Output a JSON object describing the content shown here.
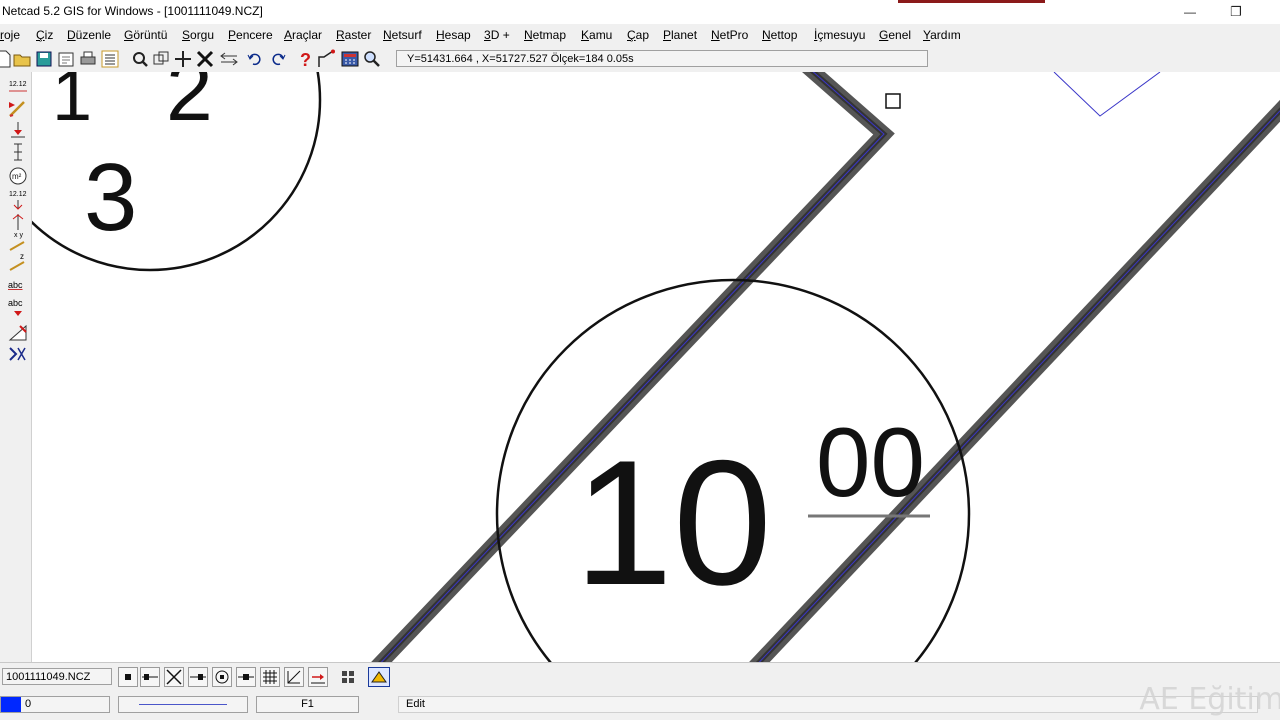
{
  "window": {
    "title": "Netcad 5.2 GIS for Windows - [1001111049.NCZ]",
    "minimize_glyph": "—",
    "restore_glyph": "❐",
    "accent_color": "#8b1a1a"
  },
  "menu": {
    "items": [
      "roje",
      "Çiz",
      "Düzenle",
      "Görüntü",
      "Sorgu",
      "Pencere",
      "Araçlar",
      "Raster",
      "Netsurf",
      "Hesap",
      "3D +",
      "Netmap",
      "Kamu",
      "Çap",
      "Planet",
      "NetPro",
      "Nettop",
      "İçmesuyu",
      "Genel",
      "Yardım"
    ]
  },
  "toolbar": {
    "icons": [
      "new-file-icon",
      "open-folder-icon",
      "save-icon",
      "print-preview-icon",
      "print-icon",
      "layers-icon",
      "zoom-icon",
      "zoom-window-icon",
      "pan-icon",
      "delete-icon",
      "move-icon",
      "undo-icon",
      "redo-icon",
      "help-icon",
      "line-tool-icon",
      "calculator-icon",
      "zoom-search-icon"
    ],
    "coordinate_readout": "Y=51431.664 , X=51727.527 Ölçek=184   0.05s"
  },
  "left_toolbar": {
    "icons": [
      "dimension-icon",
      "pen-draw-icon",
      "arrow-down-icon",
      "vertical-dimension-icon",
      "circle-area-icon",
      "text-height-icon",
      "height-icon",
      "xyz-icon",
      "elevation-icon",
      "text-abc-icon",
      "text-abc-move-icon",
      "triangle-icon",
      "snap-intersection-icon"
    ],
    "dimension_label": "12.12",
    "area_label": "m²",
    "xy_label": "x y",
    "z_label": "z",
    "abc_label": "abc"
  },
  "canvas": {
    "top_circle_digits": [
      "1",
      "2",
      "3"
    ],
    "main_circle_text": "10",
    "main_circle_superscript": "00",
    "line_color": "#3a36c8"
  },
  "statusbar": {
    "filename": "1001111049.NCZ",
    "snap_icons": [
      "snap-end-icon",
      "snap-mid-icon",
      "snap-intersect-icon",
      "snap-perpendicular-icon",
      "snap-center-icon",
      "snap-nearest-icon",
      "snap-grid-icon",
      "snap-tangent-icon",
      "snap-angle-icon",
      "snap-points-icon",
      "snap-active-icon"
    ],
    "layer_number": "0",
    "layer_color": "#0028ff",
    "function_key": "F1",
    "mode": "Edit"
  },
  "watermark": "AE Eğitim"
}
